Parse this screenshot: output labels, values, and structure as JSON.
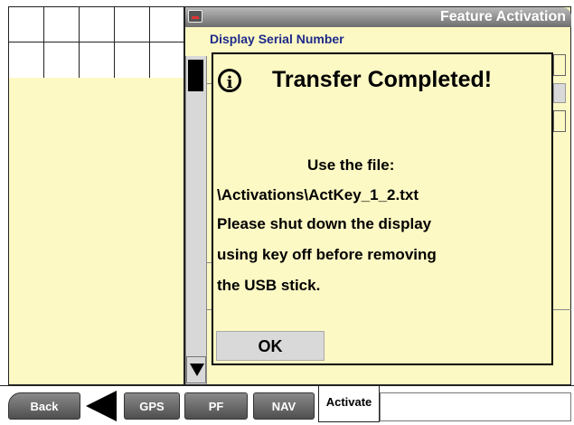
{
  "window": {
    "title": "Feature Activation"
  },
  "main": {
    "serial_label": "Display Serial Number"
  },
  "dialog": {
    "title": "Transfer Completed!",
    "icon": "info-circle-icon",
    "lines": [
      "Use the file:",
      "\\Activations\\ActKey_1_2.txt",
      "Please shut down the display",
      "using key off before removing",
      "the USB stick."
    ],
    "ok_label": "OK"
  },
  "toolbar": {
    "back_label": "Back",
    "gps_label": "GPS",
    "pf_label": "PF",
    "nav_label": "NAV",
    "activate_label": "Activate"
  },
  "colors": {
    "panel_bg": "#fdf9c4",
    "title_gradient_top": "#b9b9b9",
    "title_gradient_bottom": "#6e6e6e",
    "label_blue": "#1d2a8a"
  }
}
